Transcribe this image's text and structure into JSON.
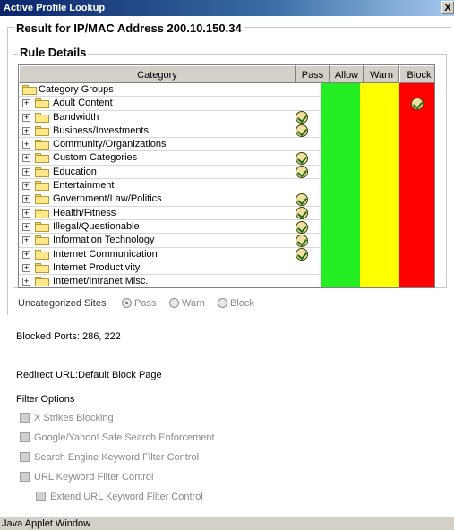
{
  "window": {
    "title": "Active Profile Lookup",
    "close_label": "X",
    "status_bar": "Java Applet Window"
  },
  "result": {
    "title": "Result for IP/MAC Address 200.10.150.34"
  },
  "rule_details": {
    "title": "Rule Details",
    "columns": [
      "Category",
      "Pass",
      "Allow",
      "Warn",
      "Block"
    ],
    "colors": {
      "allow": "#22ee22",
      "warn": "#ffff00",
      "block": "#ff0000"
    },
    "root": {
      "label": "Category Groups",
      "icon": "folder-icon"
    },
    "rows": [
      {
        "label": "Adult Content",
        "pass_check": false,
        "block_check": true
      },
      {
        "label": "Bandwidth",
        "pass_check": true,
        "block_check": false
      },
      {
        "label": "Business/Investments",
        "pass_check": true,
        "block_check": false
      },
      {
        "label": "Community/Organizations",
        "pass_check": false,
        "block_check": false
      },
      {
        "label": "Custom Categories",
        "pass_check": true,
        "block_check": false
      },
      {
        "label": "Education",
        "pass_check": true,
        "block_check": false
      },
      {
        "label": "Entertainment",
        "pass_check": false,
        "block_check": false
      },
      {
        "label": "Government/Law/Politics",
        "pass_check": true,
        "block_check": false
      },
      {
        "label": "Health/Fitness",
        "pass_check": true,
        "block_check": false
      },
      {
        "label": "Illegal/Questionable",
        "pass_check": true,
        "block_check": false
      },
      {
        "label": "Information Technology",
        "pass_check": true,
        "block_check": false
      },
      {
        "label": "Internet Communication",
        "pass_check": true,
        "block_check": false
      },
      {
        "label": "Internet Productivity",
        "pass_check": false,
        "block_check": false
      },
      {
        "label": "Internet/Intranet Misc.",
        "pass_check": false,
        "block_check": false
      }
    ]
  },
  "uncategorized": {
    "label": "Uncategorized Sites",
    "options": [
      "Pass",
      "Warn",
      "Block"
    ],
    "selected": "Pass"
  },
  "blocked_ports": "Blocked Ports: 286, 222",
  "redirect_url": "Redirect URL:Default Block Page",
  "filter_options": {
    "title": "Filter Options",
    "items": [
      "X Strikes Blocking",
      "Google/Yahoo! Safe Search Enforcement",
      "Search Engine Keyword Filter Control",
      "URL Keyword Filter Control"
    ],
    "sub_item": "Extend URL Keyword Filter Control"
  }
}
